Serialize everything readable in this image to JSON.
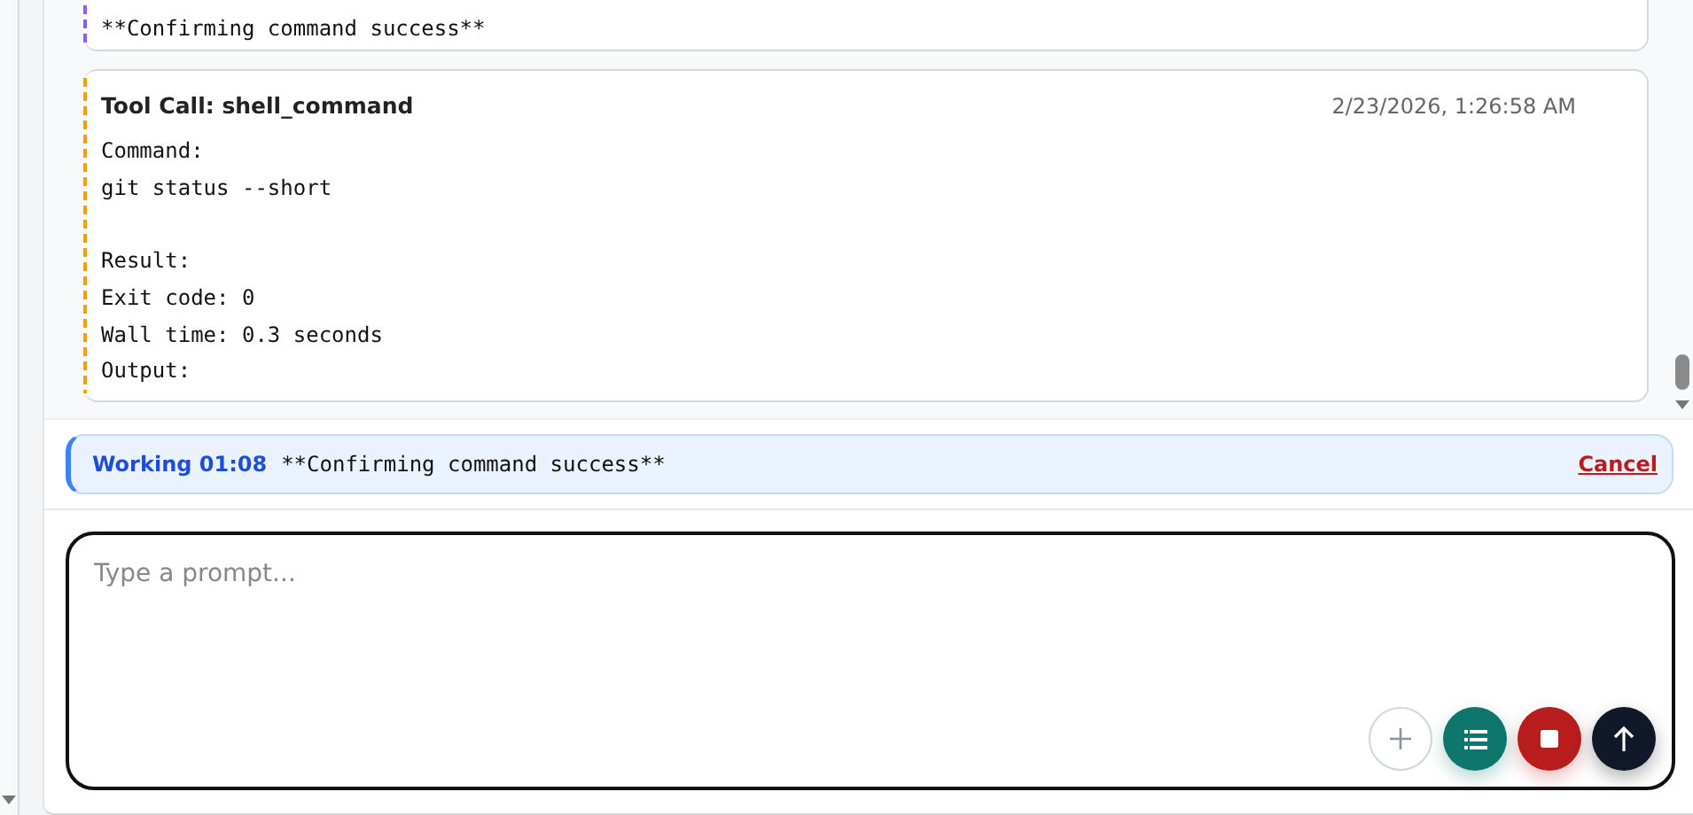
{
  "messages": [
    {
      "kind": "note",
      "color": "#8b5cf6",
      "text": "**Confirming command success**"
    },
    {
      "kind": "tool_call",
      "color": "#f59e0b",
      "title": "Tool Call: shell_command",
      "timestamp": "2/23/2026, 1:26:58 AM",
      "body": "Command:\ngit status --short\n\nResult:\nExit code: 0\nWall time: 0.3 seconds\nOutput:"
    }
  ],
  "status": {
    "label": "Working 01:08",
    "text": "**Confirming command success**",
    "action": "Cancel"
  },
  "prompt": {
    "placeholder": "Type a prompt..."
  },
  "buttons": [
    {
      "kind": "add"
    },
    {
      "kind": "list"
    },
    {
      "kind": "stop"
    },
    {
      "kind": "send"
    }
  ]
}
